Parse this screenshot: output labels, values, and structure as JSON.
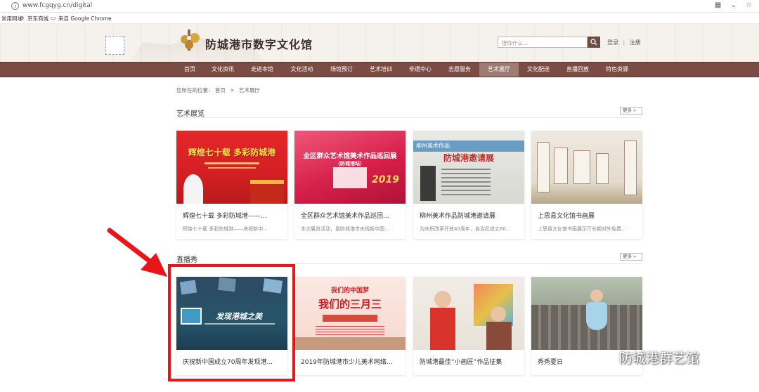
{
  "browser": {
    "url": "www.fcgqyg.cn/digital",
    "bookmarks": [
      "常用网址",
      "京东商城",
      "来自 Google Chrome"
    ]
  },
  "header": {
    "site_title": "防城港市数字文化馆",
    "search_placeholder": "搜你什么...",
    "login": "登录",
    "separator": "|",
    "register": "注册"
  },
  "nav": {
    "items": [
      "首页",
      "文化资讯",
      "走进本馆",
      "文化活动",
      "场馆预订",
      "艺术培训",
      "非遗中心",
      "志愿服务",
      "艺术展厅",
      "文化配送",
      "直播回放",
      "特色资源"
    ],
    "active_index": 8
  },
  "breadcrumb": {
    "prefix": "您所在的位置：",
    "home": "首页",
    "sep": ">",
    "current": "艺术展厅"
  },
  "sections": [
    {
      "title": "艺术展览",
      "more": "更多",
      "cards": [
        {
          "title": "辉煌七十载 多彩防城港——...",
          "desc": "辉煌七十载 多彩防城港——庆祝新中...",
          "overlay": "辉煌七十载 多彩防城港"
        },
        {
          "title": "全区群众艺术馆美术作品巡回...",
          "desc": "本次展览活动，是防城港市庆祝新中国...",
          "overlay": "全区群众艺术馆美术作品巡回展",
          "overlay2": "（防城港站）",
          "overlay3": "2019"
        },
        {
          "title": "柳州美术作品防城港邀请展",
          "desc": "为庆祝改革开放40周年、自治区成立60...",
          "overlay": "防城港邀请展",
          "overlay2": "柳州美术作品"
        },
        {
          "title": "上思县文化馆书画展",
          "desc": "上思县文化馆书画展示厅长期对外免费..."
        }
      ]
    },
    {
      "title": "直播秀",
      "more": "更多",
      "cards": [
        {
          "title": "庆祝新中国成立70周年发现港...",
          "overlay": "发现港城之美"
        },
        {
          "title": "2019年防城港市少儿美术网络...",
          "overlay": "我们的中国梦",
          "overlay2": "我们的三月三"
        },
        {
          "title": "防城港最佳“小画匠”作品征集"
        },
        {
          "title": "秀秀夏日"
        }
      ]
    }
  ],
  "watermark": "防城港群艺馆",
  "colors": {
    "nav_bg": "#7a4c44",
    "nav_active": "#9e7b73",
    "highlight_box": "#e8161b"
  }
}
